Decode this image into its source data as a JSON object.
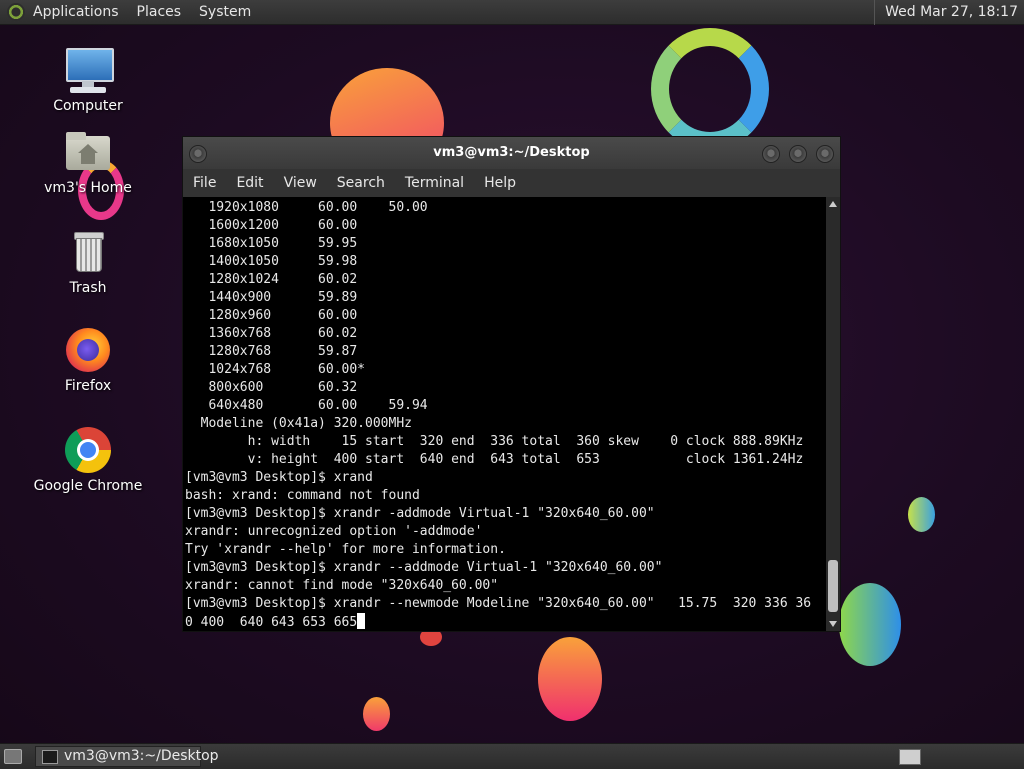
{
  "top_panel": {
    "menus": [
      "Applications",
      "Places",
      "System"
    ],
    "clock": "Wed Mar 27, 18:17"
  },
  "desktop_icons": [
    {
      "label": "Computer",
      "icon": "computer-icon"
    },
    {
      "label": "vm3's Home",
      "icon": "home-folder-icon"
    },
    {
      "label": "Trash",
      "icon": "trash-icon"
    },
    {
      "label": "Firefox",
      "icon": "firefox-icon"
    },
    {
      "label": "Google Chrome",
      "icon": "chrome-icon"
    }
  ],
  "window": {
    "title": "vm3@vm3:~/Desktop",
    "menus": [
      "File",
      "Edit",
      "View",
      "Search",
      "Terminal",
      "Help"
    ],
    "terminal_lines": [
      "   1920x1080     60.00    50.00",
      "   1600x1200     60.00",
      "   1680x1050     59.95",
      "   1400x1050     59.98",
      "   1280x1024     60.02",
      "   1440x900      59.89",
      "   1280x960      60.00",
      "   1360x768      60.02",
      "   1280x768      59.87",
      "   1024x768      60.00*",
      "   800x600       60.32",
      "   640x480       60.00    59.94",
      "  Modeline (0x41a) 320.000MHz",
      "        h: width    15 start  320 end  336 total  360 skew    0 clock 888.89KHz",
      "        v: height  400 start  640 end  643 total  653           clock 1361.24Hz",
      "[vm3@vm3 Desktop]$ xrand",
      "bash: xrand: command not found",
      "[vm3@vm3 Desktop]$ xrandr -addmode Virtual-1 \"320x640_60.00\"",
      "xrandr: unrecognized option '-addmode'",
      "Try 'xrandr --help' for more information.",
      "[vm3@vm3 Desktop]$ xrandr --addmode Virtual-1 \"320x640_60.00\"",
      "xrandr: cannot find mode \"320x640_60.00\"",
      "[vm3@vm3 Desktop]$ xrandr --newmode Modeline \"320x640_60.00\"   15.75  320 336 36",
      "0 400  640 643 653 665"
    ]
  },
  "taskbar": {
    "task_label": "vm3@vm3:~/Desktop"
  },
  "colors": {
    "panel": "#2d2d2d",
    "terminal_bg": "#000000",
    "terminal_fg": "#e9e9e9",
    "desktop_bg": "#1d0b22"
  }
}
